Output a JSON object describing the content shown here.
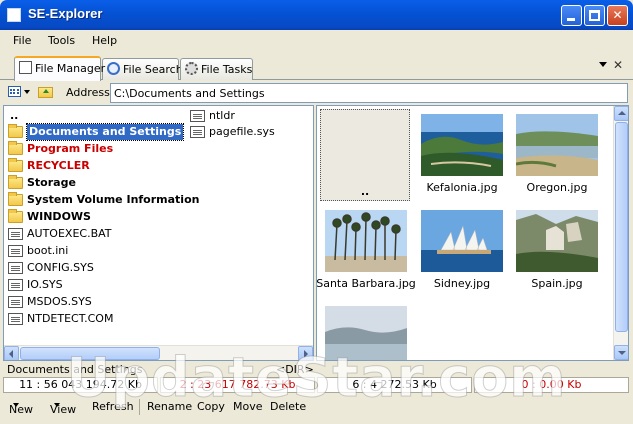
{
  "window": {
    "title": "SE-Explorer"
  },
  "menu": [
    "File",
    "Tools",
    "Help"
  ],
  "tabs": [
    {
      "label": "File Manager",
      "active": true
    },
    {
      "label": "File Search",
      "active": false
    },
    {
      "label": "File Tasks",
      "active": false
    }
  ],
  "address": {
    "label": "Address",
    "value": "C:\\Documents and Settings"
  },
  "left_pane": {
    "col1": [
      {
        "name": "..",
        "type": "up"
      },
      {
        "name": "Documents and Settings",
        "type": "folder",
        "style": "selected"
      },
      {
        "name": "Program Files",
        "type": "folder",
        "style": "red"
      },
      {
        "name": "RECYCLER",
        "type": "folder",
        "style": "red"
      },
      {
        "name": "Storage",
        "type": "folder",
        "style": "bold"
      },
      {
        "name": "System Volume Information",
        "type": "folder",
        "style": "bold"
      },
      {
        "name": "WINDOWS",
        "type": "folder",
        "style": "bold"
      },
      {
        "name": "AUTOEXEC.BAT",
        "type": "file",
        "style": ""
      },
      {
        "name": "boot.ini",
        "type": "file",
        "style": ""
      },
      {
        "name": "CONFIG.SYS",
        "type": "file",
        "style": ""
      },
      {
        "name": "IO.SYS",
        "type": "file",
        "style": ""
      },
      {
        "name": "MSDOS.SYS",
        "type": "file",
        "style": ""
      },
      {
        "name": "NTDETECT.COM",
        "type": "file",
        "style": ""
      }
    ],
    "col2": [
      {
        "name": "ntldr",
        "type": "file"
      },
      {
        "name": "pagefile.sys",
        "type": "file"
      }
    ]
  },
  "right_pane": {
    "updir_label": "..",
    "thumbnails": [
      {
        "name": "Kefalonia.jpg"
      },
      {
        "name": "Oregon.jpg"
      },
      {
        "name": "Santa Barbara.jpg"
      },
      {
        "name": "Sidney.jpg"
      },
      {
        "name": "Spain.jpg"
      },
      {
        "name": ""
      }
    ]
  },
  "status": {
    "selected_name": "Documents and Settings",
    "selected_type": "<DIR>",
    "left_count": "11 : 56 043 194.72 Kb",
    "left_selected": "2 : 23 617 782.73 Kb",
    "right_count": "6 : 4 272.53 Kb",
    "right_selected": "0 : 0.00 Kb"
  },
  "toolbar": {
    "new": "New",
    "view": "View",
    "refresh": "Refresh",
    "rename": "Rename",
    "copy": "Copy",
    "move": "Move",
    "delete": "Delete"
  },
  "watermark": "UpdateStar.com",
  "colors": {
    "accent": "#316ac5",
    "red_text": "#c80000",
    "titlebar": "#0553d6"
  }
}
